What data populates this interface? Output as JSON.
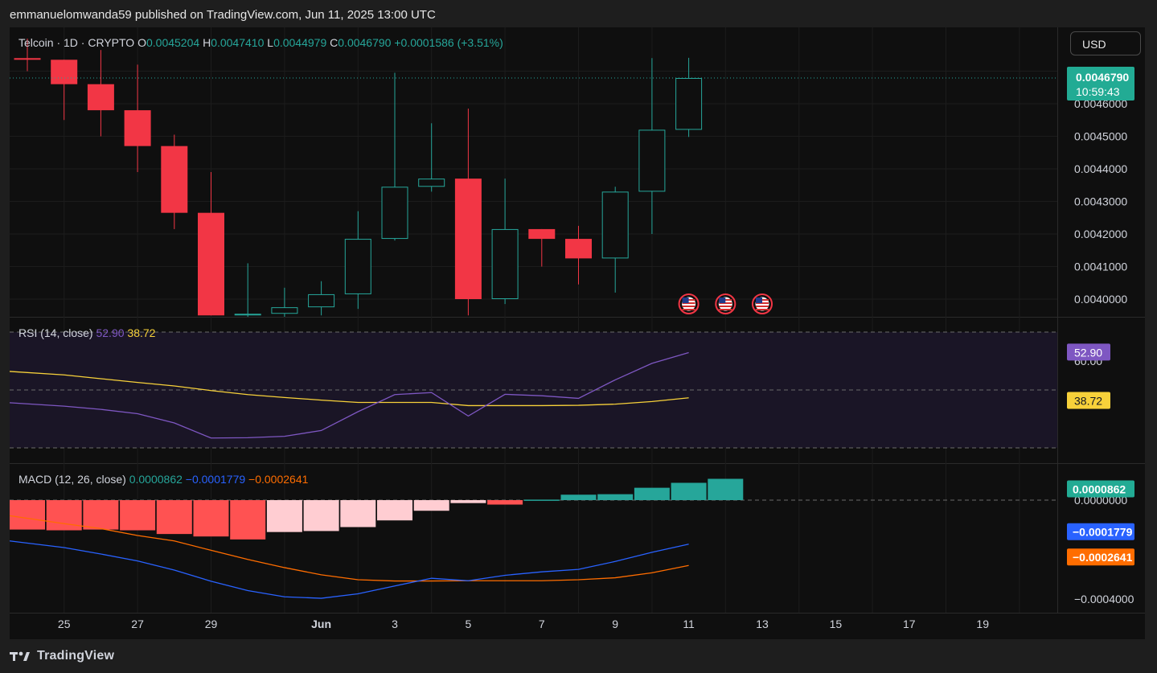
{
  "publisher_line": "emmanuelomwanda59 published on TradingView.com, Jun 11, 2025 13:00 UTC",
  "currency_button": "USD",
  "footer_brand": "TradingView",
  "colors": {
    "up": "#26a69a",
    "down": "#f23645",
    "rsi": "#7e57c2",
    "rsi_ma": "#f7d13a",
    "macd": "#2962ff",
    "signal": "#ff6d00",
    "hist_pos_strong": "#26a69a",
    "hist_neg_strong": "#ff5252",
    "hist_neg_weak": "#ffcdd2"
  },
  "price_header": {
    "symbol": "Telcoin · 1D · CRYPTO",
    "o_label": "O",
    "o": "0.0045204",
    "h_label": "H",
    "h": "0.0047410",
    "l_label": "L",
    "l": "0.0044979",
    "c_label": "C",
    "c": "0.0046790",
    "change": "+0.0001586 (+3.51%)"
  },
  "price_badge": {
    "price": "0.0046790",
    "countdown": "10:59:43"
  },
  "rsi_header": {
    "label": "RSI (14, close)",
    "value": "52.90",
    "ma_value": "38.72"
  },
  "macd_header": {
    "label": "MACD (12, 26, close)",
    "hist": "0.0000862",
    "macd": "−0.0001779",
    "signal": "−0.0002641"
  },
  "chart_data": [
    {
      "type": "candlestick",
      "title": "Telcoin · 1D · CRYPTO",
      "x": [
        "May 24",
        "May 25",
        "May 26",
        "May 27",
        "May 28",
        "May 29",
        "May 30",
        "May 31",
        "Jun 1",
        "Jun 2",
        "Jun 3",
        "Jun 4",
        "Jun 5",
        "Jun 6",
        "Jun 7",
        "Jun 8",
        "Jun 9",
        "Jun 10",
        "Jun 11"
      ],
      "x_tick_labels": [
        "25",
        "27",
        "29",
        "Jun",
        "3",
        "5",
        "7",
        "9",
        "11",
        "13",
        "15",
        "17",
        "19"
      ],
      "ylim": [
        0.00395,
        0.00481
      ],
      "y_tick_labels": [
        "0.0040000",
        "0.0041000",
        "0.0042000",
        "0.0043000",
        "0.0044000",
        "0.0045000",
        "0.0046000",
        "0.0047000"
      ],
      "candles": [
        {
          "o": 0.00474,
          "h": 0.0048,
          "l": 0.0047,
          "c": 0.004735
        },
        {
          "o": 0.004735,
          "h": 0.004735,
          "l": 0.00455,
          "c": 0.00466
        },
        {
          "o": 0.00466,
          "h": 0.004765,
          "l": 0.0045,
          "c": 0.00458
        },
        {
          "o": 0.00458,
          "h": 0.00472,
          "l": 0.00439,
          "c": 0.00447
        },
        {
          "o": 0.00447,
          "h": 0.004505,
          "l": 0.004215,
          "c": 0.004265
        },
        {
          "o": 0.004265,
          "h": 0.00439,
          "l": 0.00395,
          "c": 0.00395
        },
        {
          "o": 0.00395,
          "h": 0.00411,
          "l": 0.003935,
          "c": 0.003955
        },
        {
          "o": 0.003955,
          "h": 0.004035,
          "l": 0.003935,
          "c": 0.003975
        },
        {
          "o": 0.003975,
          "h": 0.004055,
          "l": 0.00395,
          "c": 0.004015
        },
        {
          "o": 0.004015,
          "h": 0.00427,
          "l": 0.00397,
          "c": 0.004185
        },
        {
          "o": 0.004185,
          "h": 0.004695,
          "l": 0.00418,
          "c": 0.004345
        },
        {
          "o": 0.004345,
          "h": 0.00454,
          "l": 0.00433,
          "c": 0.00437
        },
        {
          "o": 0.00437,
          "h": 0.004585,
          "l": 0.00395,
          "c": 0.004
        },
        {
          "o": 0.004,
          "h": 0.00437,
          "l": 0.003985,
          "c": 0.004215
        },
        {
          "o": 0.004215,
          "h": 0.004215,
          "l": 0.0041,
          "c": 0.004185
        },
        {
          "o": 0.004185,
          "h": 0.004225,
          "l": 0.004045,
          "c": 0.004125
        },
        {
          "o": 0.004125,
          "h": 0.004345,
          "l": 0.00402,
          "c": 0.00433
        },
        {
          "o": 0.00433,
          "h": 0.00474,
          "l": 0.0042,
          "c": 0.00452
        },
        {
          "o": 0.00452,
          "h": 0.004741,
          "l": 0.004498,
          "c": 0.004679
        }
      ],
      "event_markers": [
        "Jun 11",
        "Jun 12",
        "Jun 13"
      ],
      "last_price": 0.004679
    },
    {
      "type": "line",
      "title": "RSI (14, close)",
      "ylim": [
        20,
        76
      ],
      "bands": [
        70,
        50,
        30
      ],
      "y_tick_labels": [
        "60.00"
      ],
      "series": [
        {
          "name": "RSI",
          "values": [
            45.6,
            44.4,
            43.3,
            41.8,
            38.6,
            33.4,
            33.5,
            34.0,
            36.0,
            42.5,
            48.4,
            49.1,
            41.0,
            48.5,
            48.0,
            47.1,
            53.5,
            59.2,
            62.9
          ]
        },
        {
          "name": "MA",
          "values": [
            56.4,
            55.2,
            53.9,
            52.6,
            51.4,
            49.8,
            48.4,
            47.4,
            46.5,
            45.7,
            45.7,
            45.7,
            44.6,
            44.6,
            44.6,
            44.7,
            45.1,
            46.0,
            47.3
          ]
        }
      ],
      "value_badges": [
        "52.90",
        "38.72"
      ]
    },
    {
      "type": "bar",
      "title": "MACD (12, 26, close)",
      "ylim": [
        -0.00047,
        0.00012
      ],
      "y_tick_labels": [
        "0.0000000",
        "−0.0004000"
      ],
      "series": [
        {
          "name": "histogram",
          "values": [
            -0.000119,
            -0.000122,
            -0.000119,
            -0.000122,
            -0.000137,
            -0.000147,
            -0.000159,
            -0.000129,
            -0.000125,
            -0.000109,
            -8.2e-05,
            -4.3e-05,
            -1.2e-05,
            -1.8e-05,
            2e-06,
            2.2e-05,
            2.4e-05,
            5e-05,
            7e-05,
            8.62e-05
          ]
        },
        {
          "name": "MACD",
          "values": [
            -0.000165,
            -0.000192,
            -0.000218,
            -0.000246,
            -0.000283,
            -0.000328,
            -0.000366,
            -0.000391,
            -0.000397,
            -0.000379,
            -0.000347,
            -0.000316,
            -0.000326,
            -0.000304,
            -0.00029,
            -0.00028,
            -0.000248,
            -0.000211,
            -0.0001779
          ]
        },
        {
          "name": "Signal",
          "values": [
            -6.3e-05,
            -9.5e-05,
            -0.000115,
            -0.000143,
            -0.000165,
            -0.000203,
            -0.00024,
            -0.000273,
            -0.000302,
            -0.000322,
            -0.000327,
            -0.000327,
            -0.000326,
            -0.000326,
            -0.000326,
            -0.000322,
            -0.000314,
            -0.000294,
            -0.0002641
          ]
        }
      ],
      "value_badges": [
        "0.0000862",
        "−0.0001779",
        "−0.0002641"
      ]
    }
  ]
}
